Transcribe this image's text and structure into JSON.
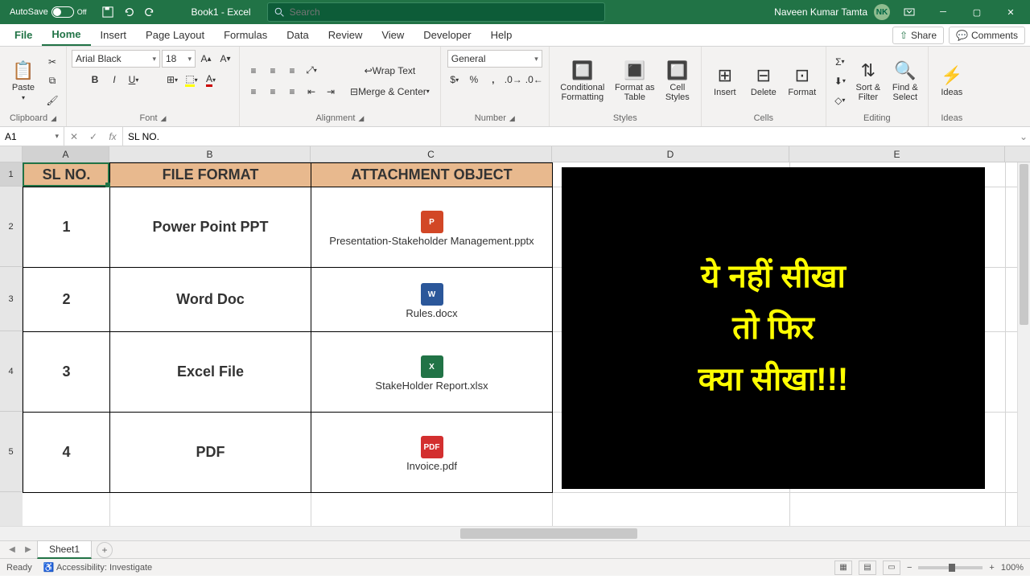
{
  "titlebar": {
    "autosave_label": "AutoSave",
    "autosave_state": "Off",
    "doc_title": "Book1  -  Excel",
    "search_placeholder": "Search",
    "user_name": "Naveen Kumar Tamta",
    "user_initials": "NK"
  },
  "tabs": {
    "file": "File",
    "list": [
      "Home",
      "Insert",
      "Page Layout",
      "Formulas",
      "Data",
      "Review",
      "View",
      "Developer",
      "Help"
    ],
    "active": "Home",
    "share": "Share",
    "comments": "Comments"
  },
  "ribbon": {
    "clipboard": {
      "paste": "Paste",
      "label": "Clipboard"
    },
    "font": {
      "name": "Arial Black",
      "size": "18",
      "label": "Font"
    },
    "alignment": {
      "wrap": "Wrap Text",
      "merge": "Merge & Center",
      "label": "Alignment"
    },
    "number": {
      "format": "General",
      "label": "Number"
    },
    "styles": {
      "cond": "Conditional Formatting",
      "table": "Format as Table",
      "cell": "Cell Styles",
      "label": "Styles"
    },
    "cells": {
      "insert": "Insert",
      "delete": "Delete",
      "format": "Format",
      "label": "Cells"
    },
    "editing": {
      "sort": "Sort & Filter",
      "find": "Find & Select",
      "label": "Editing"
    },
    "ideas": {
      "btn": "Ideas",
      "label": "Ideas"
    }
  },
  "formula": {
    "cell_ref": "A1",
    "value": "SL NO."
  },
  "columns": {
    "letters": [
      "A",
      "B",
      "C",
      "D",
      "E"
    ],
    "widths": [
      108,
      250,
      300,
      295,
      268
    ]
  },
  "rows": {
    "heights": [
      30,
      100,
      80,
      100,
      100
    ],
    "count": 5
  },
  "table": {
    "headers": [
      "SL NO.",
      "FILE FORMAT",
      "ATTACHMENT OBJECT"
    ],
    "rows": [
      {
        "sl": "1",
        "format": "Power Point PPT",
        "file": "Presentation-Stakeholder Management.pptx",
        "icon": "ppt",
        "icon_text": "P"
      },
      {
        "sl": "2",
        "format": "Word Doc",
        "file": "Rules.docx",
        "icon": "doc",
        "icon_text": "W"
      },
      {
        "sl": "3",
        "format": "Excel File",
        "file": "StakeHolder Report.xlsx",
        "icon": "xls",
        "icon_text": "X"
      },
      {
        "sl": "4",
        "format": "PDF",
        "file": "Invoice.pdf",
        "icon": "pdf",
        "icon_text": "PDF"
      }
    ]
  },
  "overlay": {
    "line1": "ये नहीं सीखा",
    "line2": "तो फिर",
    "line3": "क्या सीखा!!!"
  },
  "sheet": {
    "name": "Sheet1"
  },
  "status": {
    "ready": "Ready",
    "accessibility": "Accessibility: Investigate",
    "zoom": "100%"
  }
}
